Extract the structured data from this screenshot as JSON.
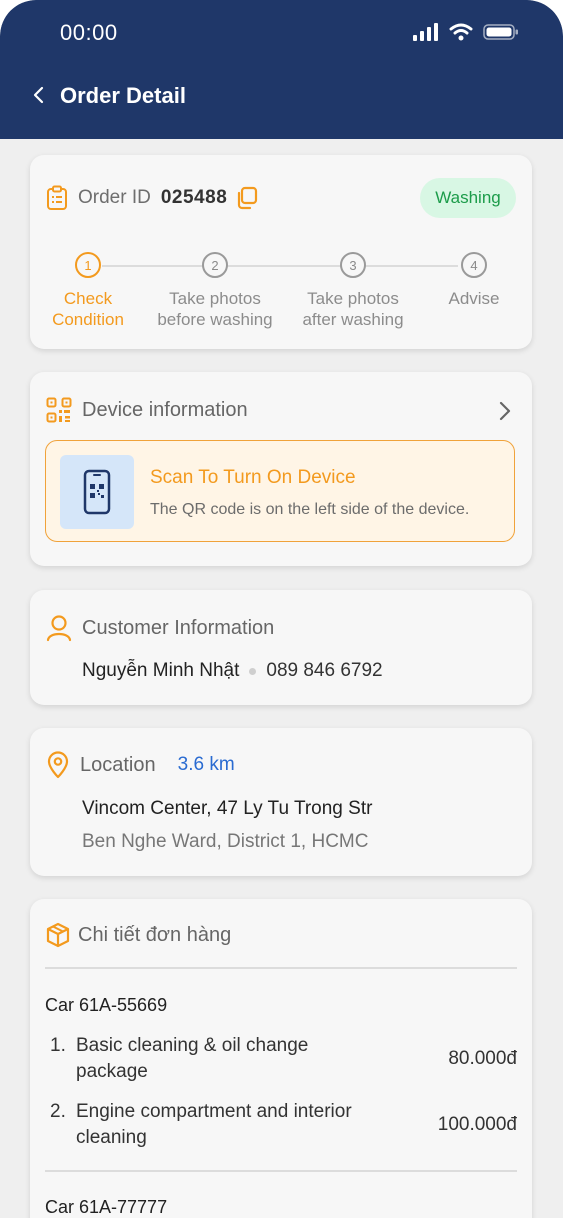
{
  "status_bar": {
    "time": "00:00"
  },
  "header": {
    "title": "Order Detail"
  },
  "order": {
    "label": "Order ID",
    "id": "025488",
    "status": "Washing",
    "steps": [
      {
        "num": "1",
        "line1": "Check",
        "line2": "Condition",
        "active": true
      },
      {
        "num": "2",
        "line1": "Take photos",
        "line2": "before washing",
        "active": false
      },
      {
        "num": "3",
        "line1": "Take photos",
        "line2": "after washing",
        "active": false
      },
      {
        "num": "4",
        "line1": "Advise",
        "line2": "",
        "active": false
      }
    ]
  },
  "device": {
    "title": "Device information",
    "scan_title": "Scan To Turn On Device",
    "scan_subtitle": "The QR code is on the left side of the device."
  },
  "customer": {
    "title": "Customer Information",
    "name": "Nguyễn Minh Nhật",
    "phone": "089 846 6792"
  },
  "location": {
    "title": "Location",
    "distance": "3.6 km",
    "address_line1": "Vincom Center, 47 Ly Tu Trong Str",
    "address_line2": "Ben Nghe Ward, District 1, HCMC"
  },
  "order_details": {
    "title": "Chi tiết đơn hàng",
    "cars": [
      {
        "name": "Car 61A-55669",
        "items": [
          {
            "num": "1.",
            "line1": "Basic cleaning & oil change",
            "line2": "package",
            "price": "80.000đ"
          },
          {
            "num": "2.",
            "line1": "Engine compartment and interior",
            "line2": "cleaning",
            "price": "100.000đ"
          }
        ]
      },
      {
        "name": "Car 61A-77777",
        "items": []
      }
    ]
  },
  "colors": {
    "header_bg": "#1f3769",
    "accent": "#f39a1e",
    "status_green": "#1c9c4a",
    "link_blue": "#2a6bd1"
  }
}
